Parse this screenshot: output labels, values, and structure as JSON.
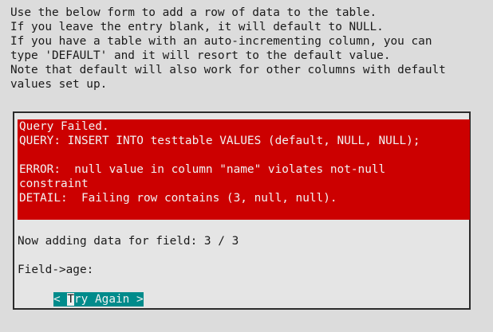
{
  "intro": {
    "lines": [
      "Use the below form to add a row of data to the table.",
      "If you leave the entry blank, it will default to NULL.",
      "If you have a table with an auto-incrementing column, you can",
      "type 'DEFAULT' and it will resort to the default value.",
      "Note that default will also work for other columns with default",
      "values set up."
    ]
  },
  "error": {
    "lines": [
      "Query Failed.",
      "QUERY: INSERT INTO testtable VALUES (default, NULL, NULL);",
      "",
      "ERROR:  null value in column \"name\" violates not-null",
      "constraint",
      "DETAIL:  Failing row contains (3, null, null)."
    ],
    "background_color": "#cc0000"
  },
  "status_text": "Now adding data for field: 3 / 3",
  "field_prompt": "Field->age:",
  "button": {
    "prefix": "< ",
    "hotkey": "T",
    "rest": "ry Again >",
    "color": "#008b8b"
  }
}
